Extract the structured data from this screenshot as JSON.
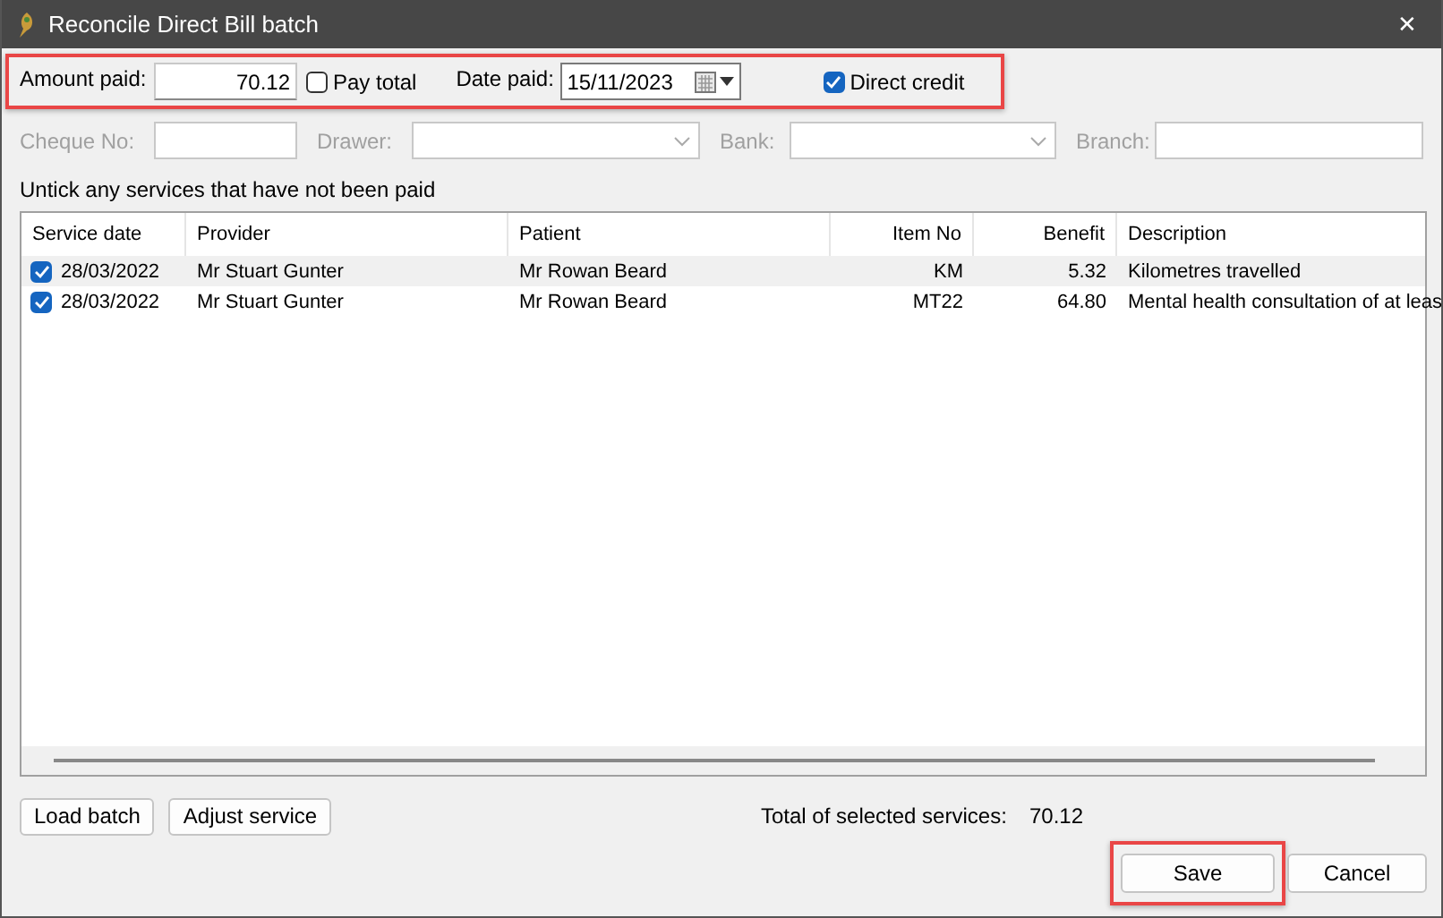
{
  "window": {
    "title": "Reconcile Direct Bill batch",
    "close": "✕"
  },
  "payment": {
    "highlighted": true,
    "amount_label": "Amount paid:",
    "amount": "70.12",
    "pay_total": {
      "label": "Pay total",
      "checked": false
    },
    "date_label": "Date paid:",
    "date": "15/11/2023",
    "direct_credit": {
      "label": "Direct credit",
      "checked": true
    }
  },
  "cheque": {
    "disabled": true,
    "cheque_label": "Cheque No:",
    "drawer_label": "Drawer:",
    "bank_label": "Bank:",
    "branch_label": "Branch:"
  },
  "instruction": "Untick any services that have not been paid",
  "table": {
    "columns": [
      {
        "label": "Service date",
        "kind": "text"
      },
      {
        "label": "Provider",
        "kind": "text"
      },
      {
        "label": "Patient",
        "kind": "text"
      },
      {
        "label": "Item No",
        "kind": "number"
      },
      {
        "label": "Benefit",
        "kind": "number"
      },
      {
        "label": "Description",
        "kind": "text"
      }
    ],
    "rows": [
      {
        "checked": true,
        "selected": true,
        "cells": [
          "28/03/2022",
          "Mr Stuart Gunter",
          "Mr Rowan Beard",
          "KM",
          "5.32",
          "Kilometres travelled"
        ]
      },
      {
        "checked": true,
        "selected": false,
        "cells": [
          "28/03/2022",
          "Mr Stuart Gunter",
          "Mr Rowan Beard",
          "MT22",
          "64.80",
          "Mental health consultation of at leas"
        ]
      }
    ]
  },
  "buttons_left": [
    "Load batch",
    "Adjust service"
  ],
  "total": {
    "label": "Total of selected services:",
    "value": "70.12"
  },
  "buttons_right": [
    {
      "label": "Save",
      "highlighted": true
    },
    {
      "label": "Cancel",
      "highlighted": false
    }
  ]
}
